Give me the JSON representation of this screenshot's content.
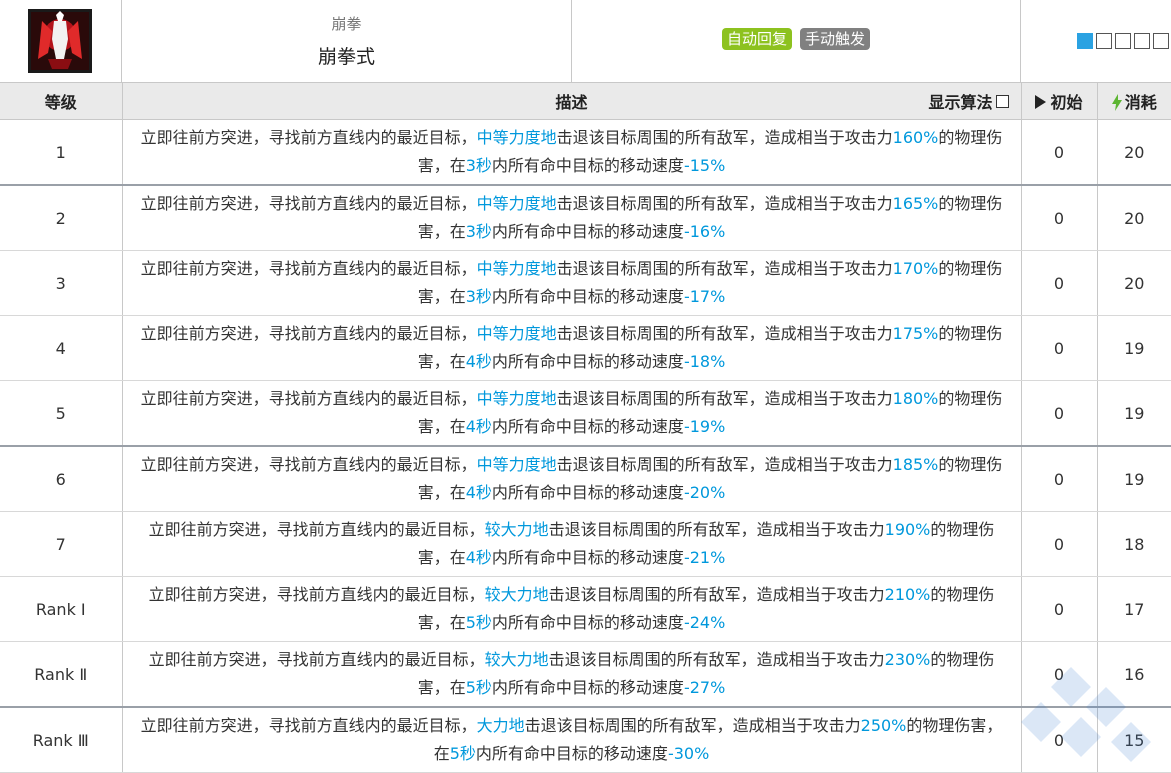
{
  "skill": {
    "sub_name": "崩拳",
    "name": "崩拳式",
    "tags": [
      "自动回复",
      "手动触发"
    ],
    "icon": "skill-fist-icon",
    "level_slots_total": 5,
    "level_slots_filled": 1
  },
  "headers": {
    "level": "等级",
    "desc": "描述",
    "show_formula": "显示算法",
    "initial": "初始",
    "cost": "消耗"
  },
  "desc_parts": {
    "p1": "立即往前方突进，寻找前方直线内的最近目标，",
    "p2": "击退该目标周围的所有敌军，造成相当于攻击力",
    "p3": "的物理伤害，在",
    "p4": "内所有命中目标的移动速度"
  },
  "rows": [
    {
      "level": "1",
      "force": "中等力度地",
      "atk": "160%",
      "dur": "3秒",
      "slow": "-15%",
      "init": "0",
      "cost": "20"
    },
    {
      "level": "2",
      "force": "中等力度地",
      "atk": "165%",
      "dur": "3秒",
      "slow": "-16%",
      "init": "0",
      "cost": "20"
    },
    {
      "level": "3",
      "force": "中等力度地",
      "atk": "170%",
      "dur": "3秒",
      "slow": "-17%",
      "init": "0",
      "cost": "20"
    },
    {
      "level": "4",
      "force": "中等力度地",
      "atk": "175%",
      "dur": "4秒",
      "slow": "-18%",
      "init": "0",
      "cost": "19"
    },
    {
      "level": "5",
      "force": "中等力度地",
      "atk": "180%",
      "dur": "4秒",
      "slow": "-19%",
      "init": "0",
      "cost": "19"
    },
    {
      "level": "6",
      "force": "中等力度地",
      "atk": "185%",
      "dur": "4秒",
      "slow": "-20%",
      "init": "0",
      "cost": "19"
    },
    {
      "level": "7",
      "force": "较大力地",
      "atk": "190%",
      "dur": "4秒",
      "slow": "-21%",
      "init": "0",
      "cost": "18"
    },
    {
      "level": "Rank Ⅰ",
      "force": "较大力地",
      "atk": "210%",
      "dur": "5秒",
      "slow": "-24%",
      "init": "0",
      "cost": "17"
    },
    {
      "level": "Rank Ⅱ",
      "force": "较大力地",
      "atk": "230%",
      "dur": "5秒",
      "slow": "-27%",
      "init": "0",
      "cost": "16"
    },
    {
      "level": "Rank Ⅲ",
      "force": "大力地",
      "atk": "250%",
      "dur": "5秒",
      "slow": "-30%",
      "init": "0",
      "cost": "15"
    }
  ],
  "colors": {
    "highlight": "#0098dc",
    "tag_auto": "#8dc21f",
    "tag_manual": "#808080",
    "slot_filled": "#2aa2e2",
    "bolt": "#5cb531"
  }
}
